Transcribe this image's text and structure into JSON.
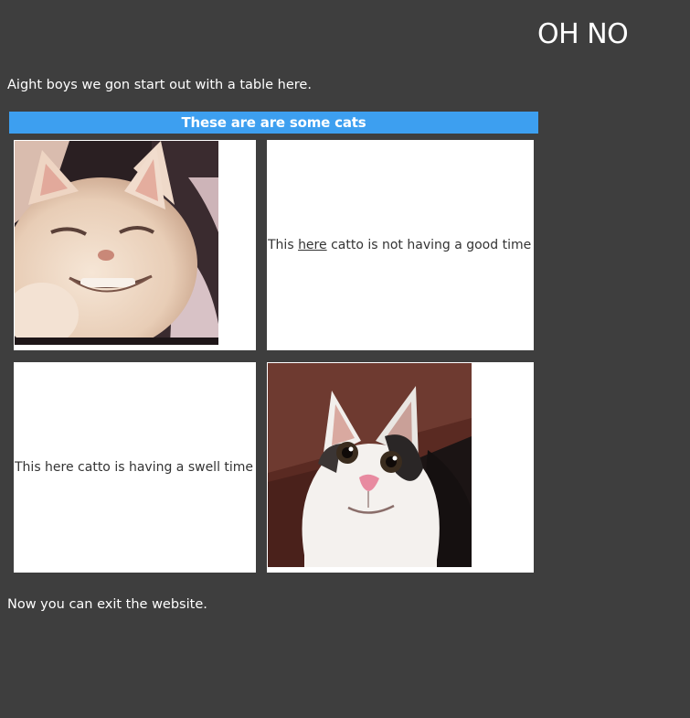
{
  "header": {
    "title": "OH NO"
  },
  "intro_text": "Aight boys we gon start out with a table here.",
  "table": {
    "caption": "These are are some cats",
    "cell_sad": {
      "pre": "This ",
      "link": "here",
      "post": " catto is not having a good time"
    },
    "cell_happy": "This here catto is having a swell time",
    "images": [
      "smug-white-cat-photo",
      "polite-cat-photo"
    ]
  },
  "outro_text": "Now you can exit the website.",
  "colors": {
    "background": "#3e3e3e",
    "caption_bar": "#3d9ff0",
    "cell": "#ffffff",
    "cell_text": "#333333"
  }
}
